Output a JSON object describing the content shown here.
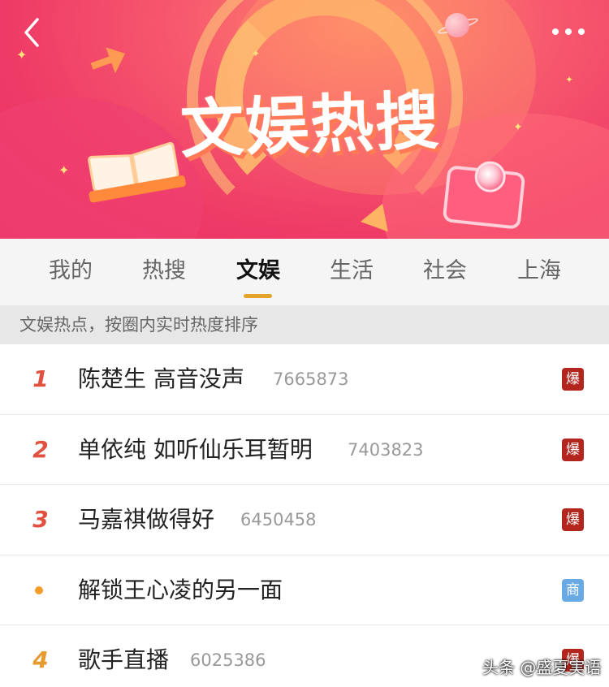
{
  "banner": {
    "title": "文娱热搜"
  },
  "icons": {
    "back": "chevron-left-icon",
    "more": "more-dots-icon"
  },
  "tabs": [
    {
      "label": "我的",
      "active": false
    },
    {
      "label": "热搜",
      "active": false
    },
    {
      "label": "文娱",
      "active": true
    },
    {
      "label": "生活",
      "active": false
    },
    {
      "label": "社会",
      "active": false
    },
    {
      "label": "上海",
      "active": false
    }
  ],
  "hint": "文娱热点，按圈内实时热度排序",
  "list": [
    {
      "rank": "1",
      "title": "陈楚生 高音没声",
      "count": "7665873",
      "badge": "爆"
    },
    {
      "rank": "2",
      "title": "单依纯 如听仙乐耳暂明",
      "count": "7403823",
      "badge": "爆"
    },
    {
      "rank": "3",
      "title": "马嘉祺做得好",
      "count": "6450458",
      "badge": "爆"
    },
    {
      "rank": "",
      "title": "解锁王心凌的另一面",
      "count": "",
      "badge": "商"
    },
    {
      "rank": "4",
      "title": "歌手直播",
      "count": "6025386",
      "badge": "爆"
    }
  ],
  "watermark": "头条 @盛夏実语",
  "colors": {
    "rank_top": "#e0513f",
    "rank_other": "#e69b2f",
    "badge_hot": "#b3261e",
    "badge_ad": "#6aaae4",
    "tab_underline": "#e2a52a"
  }
}
